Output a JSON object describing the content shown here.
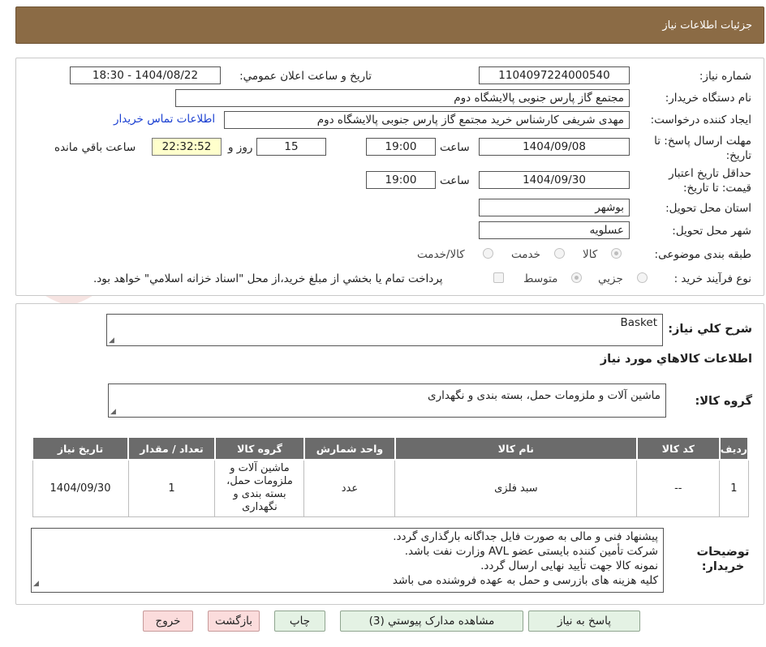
{
  "header": {
    "title": "جزئیات اطلاعات نیاز"
  },
  "labels": {
    "need_number": "شماره نیاز:",
    "announce_datetime": "تاریخ و ساعت اعلان عمومي:",
    "buyer_org": "نام دستگاه خريدار:",
    "requester": "ايجاد کننده درخواست:",
    "deadline_send": "مهلت ارسال پاسخ: تا تاریخ:",
    "time": "ساعت",
    "days": "روز و",
    "remaining": "ساعت باقي مانده",
    "price_validity": "حداقل تاريخ اعتبار قيمت: تا تاريخ:",
    "delivery_province": "استان محل تحويل:",
    "delivery_city": "شهر محل تحويل:",
    "category": "طبقه بندی موضوعی:",
    "purchase_type": "نوع فرآيند خريد :",
    "general_desc": "شرح كلي نياز:",
    "goods_info": "اطلاعات كالاهاي مورد نياز",
    "goods_group": "گروه کالا:",
    "buyer_notes": "توضيحات خريدار:"
  },
  "values": {
    "need_number": "1104097224000540",
    "announce_datetime": "1404/08/22 - 18:30",
    "buyer_org": "مجتمع گاز پارس جنوبی  پالایشگاه دوم",
    "requester": "مهدی شریفی کارشناس خرید مجتمع گاز پارس جنوبی  پالایشگاه دوم",
    "contact_link": "اطلاعات تماس خريدار",
    "deadline_date": "1404/09/08",
    "deadline_time": "19:00",
    "days_left": "15",
    "time_left": "22:32:52",
    "validity_date": "1404/09/30",
    "validity_time": "19:00",
    "province": "بوشهر",
    "city": "عسلويه",
    "general_desc": "Basket",
    "goods_group": "ماشین آلات و ملزومات حمل، بسته بندی و نگهداری"
  },
  "category_options": [
    "کالا",
    "خدمت",
    "کالا/خدمت"
  ],
  "purchase_options": [
    "جزيي",
    "متوسط"
  ],
  "purchase_note": "پرداخت تمام يا بخشي از مبلغ خريد،از محل \"اسناد خزانه اسلامي\" خواهد بود.",
  "table": {
    "headers": [
      "رديف",
      "کد کالا",
      "نام کالا",
      "واحد شمارش",
      "گروه کالا",
      "تعداد / مقدار",
      "تاريخ نياز"
    ],
    "rows": [
      [
        "1",
        "--",
        "سبد فلزی",
        "عدد",
        "ماشین آلات و ملزومات حمل، بسته بندی و نگهداری",
        "1",
        "1404/09/30"
      ]
    ]
  },
  "buyer_notes_lines": [
    "پیشنهاد فنی و مالی به صورت فایل جداگانه بارگذاری گردد.",
    "شرکت تأمین کننده بایستی عضو AVL وزارت نفت باشد.",
    "نمونه کالا جهت تأیید نهایی ارسال گردد.",
    "کلیه هزینه های بازرسی و حمل به عهده فروشنده می باشد"
  ],
  "buttons": {
    "reply": "پاسخ به نياز",
    "attachments": "مشاهده مدارک پيوستي (3)",
    "print": "چاپ",
    "back": "بازگشت",
    "exit": "خروج"
  },
  "watermark": "AriaTender.neT",
  "colors": {
    "header": "#8b6b45",
    "table_header": "#6b6b6b",
    "link": "#1a3fd1",
    "button": "#e4f2e4",
    "button_pink": "#fbdcdc"
  }
}
